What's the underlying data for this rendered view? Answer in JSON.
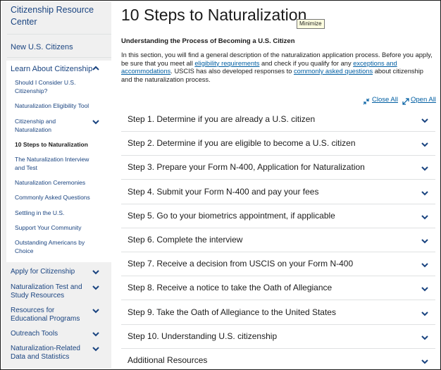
{
  "sidebar": {
    "title": "Citizenship Resource Center",
    "new_citizens": "New U.S. Citizens",
    "learn": "Learn About Citizenship",
    "sub_items": [
      "Should I Consider U.S. Citizenship?",
      "Naturalization Eligibility Tool",
      "Citizenship and Naturalization",
      "10 Steps to Naturalization",
      "The Naturalization Interview and Test",
      "Naturalization Ceremonies",
      "Commonly Asked Questions",
      "Settling in the U.S.",
      "Support Your Community",
      "Outstanding Americans by Choice"
    ],
    "main_items": [
      "Apply for Citizenship",
      "Naturalization Test and Study Resources",
      "Resources for Educational Programs",
      "Outreach Tools",
      "Naturalization-Related Data and Statistics"
    ]
  },
  "main": {
    "title": "10 Steps to Naturalization",
    "tooltip": "Minimize",
    "subtitle": "Understanding the Process of Becoming a U.S. Citizen",
    "intro": {
      "t1": "In this section, you will find a general description of the naturalization application process. Before you apply, be sure that you meet all ",
      "l1": "eligibility requirements",
      "t2": " and check if you qualify for any ",
      "l2": "exceptions and accommodations",
      "t3": ". USCIS has also developed responses to ",
      "l3": "commonly asked questions",
      "t4": " about citizenship and the naturalization process."
    },
    "close_all": "Close All",
    "open_all": "Open All",
    "steps": [
      "Step 1. Determine if you are already a U.S. citizen",
      "Step 2. Determine if you are eligible to become a U.S. citizen",
      "Step 3. Prepare your Form N-400, Application for Naturalization",
      "Step 4. Submit your Form N-400 and pay your fees",
      "Step 5. Go to your biometrics appointment, if applicable",
      "Step 6. Complete the interview",
      "Step 7. Receive a decision from USCIS on your Form N-400",
      "Step 8. Receive a notice to take the Oath of Allegiance",
      "Step 9. Take the Oath of Allegiance to the United States",
      "Step 10. Understanding U.S. citizenship",
      "Additional Resources"
    ]
  },
  "colors": {
    "link": "#005ea2",
    "nav": "#1a4480",
    "sidebar_bg": "#f0f0f0"
  }
}
